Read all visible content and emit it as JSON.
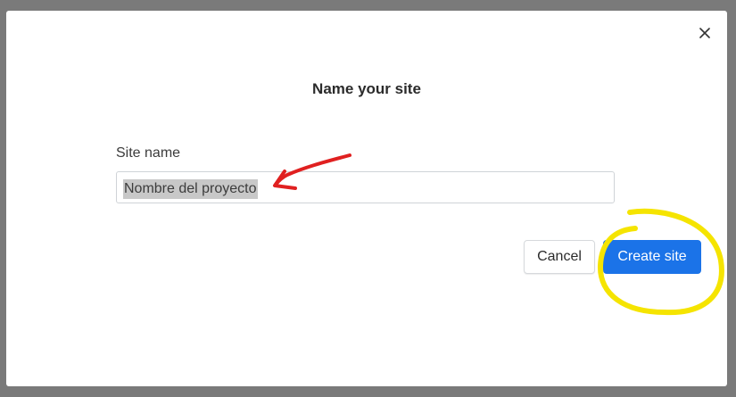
{
  "dialog": {
    "title": "Name your site",
    "close_icon": "close-icon",
    "field": {
      "label": "Site name",
      "value": "Nombre del proyecto"
    },
    "buttons": {
      "cancel_label": "Cancel",
      "create_label": "Create site"
    }
  },
  "colors": {
    "backdrop": "#7a7a7a",
    "primary": "#1b73e8",
    "annotation_arrow": "#e02020",
    "annotation_circle": "#f5e400"
  }
}
